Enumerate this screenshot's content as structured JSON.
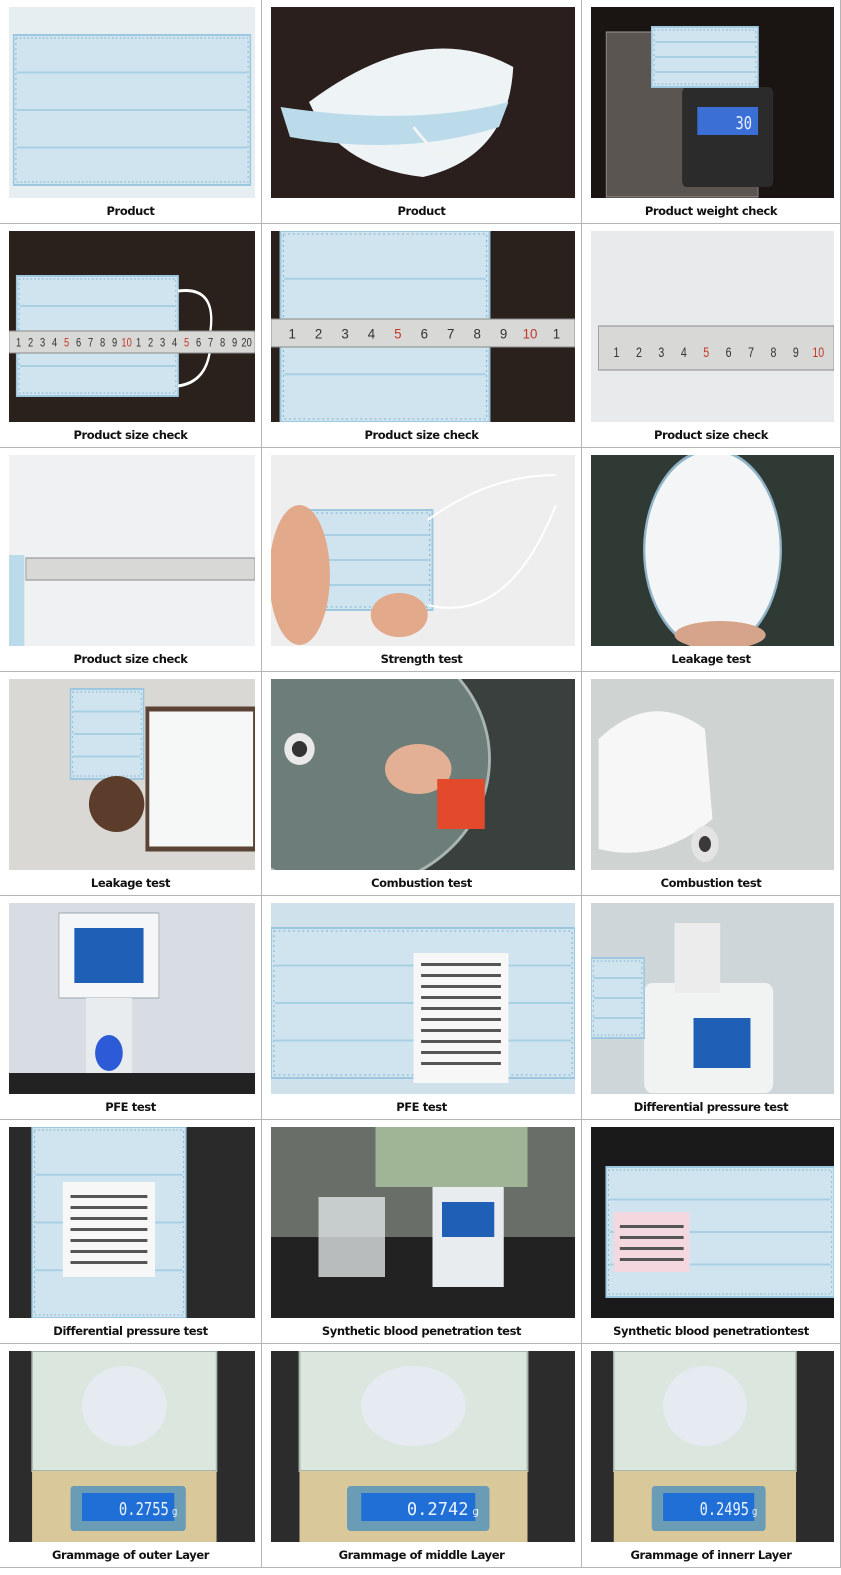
{
  "rows": [
    {
      "cells": [
        {
          "caption": "Product",
          "scene": "mask-flat"
        },
        {
          "caption": "Product",
          "scene": "mask-cup"
        },
        {
          "caption": "Product weight check",
          "scene": "scale-small",
          "readout": "30"
        }
      ]
    },
    {
      "cells": [
        {
          "caption": "Product size check",
          "scene": "ruler-mask-wide",
          "ruler": "1 2 3 4 5 6 7 8 9 10 1 2 3 4 5 6 7 8 9 20"
        },
        {
          "caption": "Product size check",
          "scene": "ruler-mask-tall",
          "ruler": "1 2 3 4 5 6 7 8 9 10 1"
        },
        {
          "caption": "Product size check",
          "scene": "ruler-plain",
          "ruler": "1 2 3 4 5 6 7 8 9 10"
        }
      ]
    },
    {
      "cells": [
        {
          "caption": "Product size check",
          "scene": "ruler-corner"
        },
        {
          "caption": "Strength test",
          "scene": "strength"
        },
        {
          "caption": "Leakage test",
          "scene": "leak-inner"
        }
      ]
    },
    {
      "cells": [
        {
          "caption": "Leakage test",
          "scene": "leak-hold"
        },
        {
          "caption": "Combustion test",
          "scene": "combustion-1"
        },
        {
          "caption": "Combustion test",
          "scene": "combustion-2"
        }
      ]
    },
    {
      "cells": [
        {
          "caption": "PFE test",
          "scene": "pfe-machine"
        },
        {
          "caption": "PFE test",
          "scene": "pfe-receipt"
        },
        {
          "caption": "Differential pressure test",
          "scene": "dp-machine"
        }
      ]
    },
    {
      "cells": [
        {
          "caption": "Differential pressure test",
          "scene": "dp-receipt"
        },
        {
          "caption": "Synthetic blood penetration test",
          "scene": "blood-machine"
        },
        {
          "caption": "Synthetic blood penetrationtest",
          "scene": "blood-receipt"
        }
      ]
    },
    {
      "cells": [
        {
          "caption": "Grammage of outer Layer",
          "scene": "balance",
          "readout": "0.2755"
        },
        {
          "caption": "Grammage of middle Layer",
          "scene": "balance",
          "readout": "0.2742"
        },
        {
          "caption": "Grammage of innerr Layer",
          "scene": "balance",
          "readout": "0.2495"
        }
      ]
    }
  ]
}
